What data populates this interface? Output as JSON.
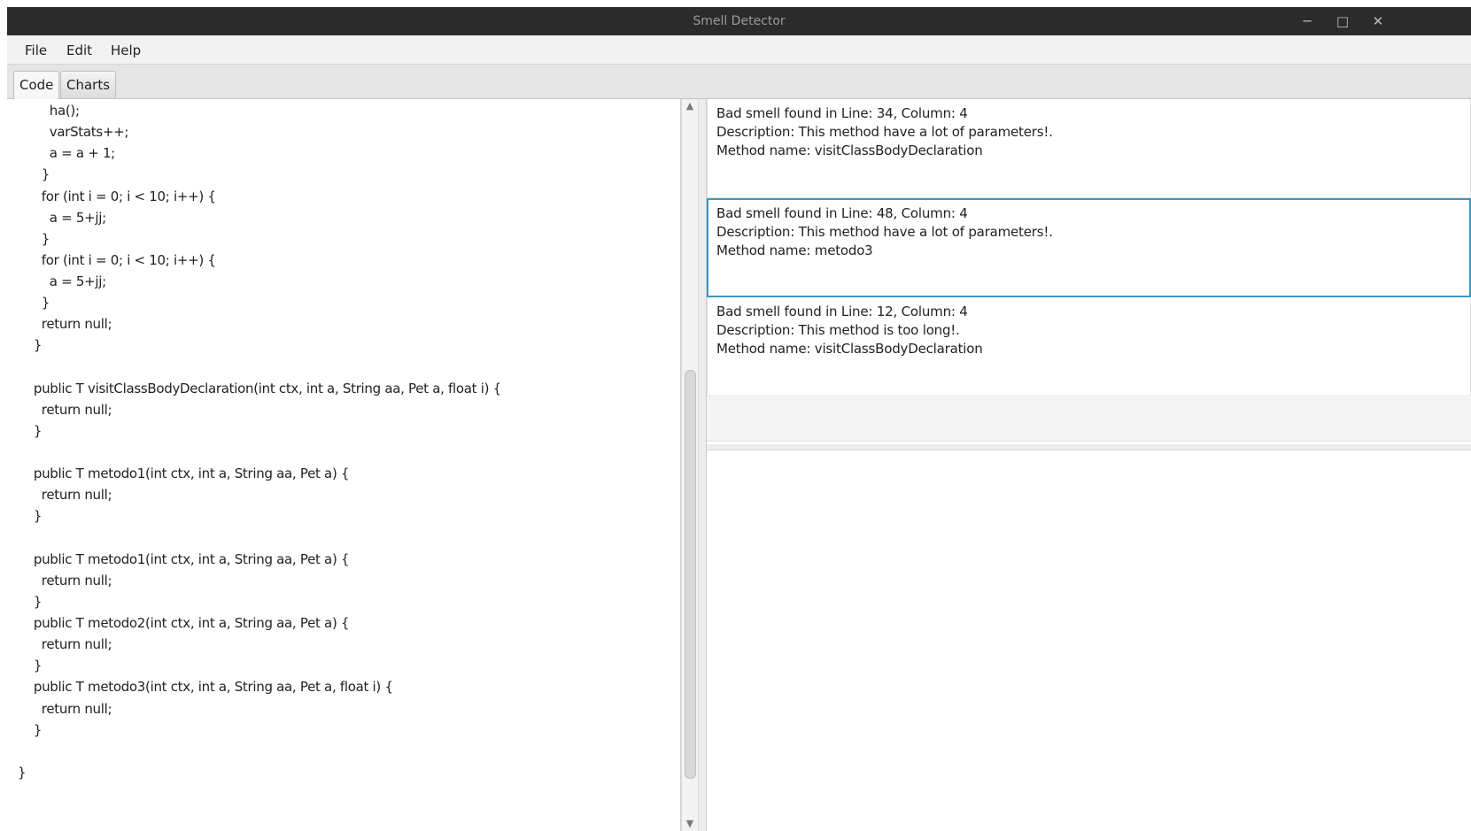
{
  "window": {
    "title": "Smell Detector",
    "minimize_glyph": "─",
    "maximize_glyph": "□",
    "close_glyph": "✕"
  },
  "menu": {
    "file": "File",
    "edit": "Edit",
    "help": "Help"
  },
  "tabs": {
    "code": "Code",
    "charts": "Charts"
  },
  "code": {
    "text": "        ha();\n        varStats++;\n        a = a + 1;\n      }\n      for (int i = 0; i < 10; i++) {\n        a = 5+jj;\n      }\n      for (int i = 0; i < 10; i++) {\n        a = 5+jj;\n      }\n      return null;\n    }\n\n    public T visitClassBodyDeclaration(int ctx, int a, String aa, Pet a, float i) {\n      return null;\n    }\n\n    public T metodo1(int ctx, int a, String aa, Pet a) {\n      return null;\n    }\n\n    public T metodo1(int ctx, int a, String aa, Pet a) {\n      return null;\n    }\n    public T metodo2(int ctx, int a, String aa, Pet a) {\n      return null;\n    }\n    public T metodo3(int ctx, int a, String aa, Pet a, float i) {\n      return null;\n    }\n\n}"
  },
  "scrollbar": {
    "up_glyph": "▲",
    "down_glyph": "▼"
  },
  "smells": [
    {
      "location": "Bad smell found in Line: 34, Column: 4",
      "description": "Description: This method have a lot of parameters!.",
      "method": "Method name: visitClassBodyDeclaration"
    },
    {
      "location": "Bad smell found in Line: 48, Column: 4",
      "description": "Description: This method have a lot of parameters!.",
      "method": "Method name: metodo3"
    },
    {
      "location": "Bad smell found in Line: 12, Column: 4",
      "description": "Description: This method is too long!.",
      "method": "Method name: visitClassBodyDeclaration"
    }
  ],
  "colors": {
    "titlebar": "#2b2b2b",
    "selection_border": "#3d98c4"
  }
}
